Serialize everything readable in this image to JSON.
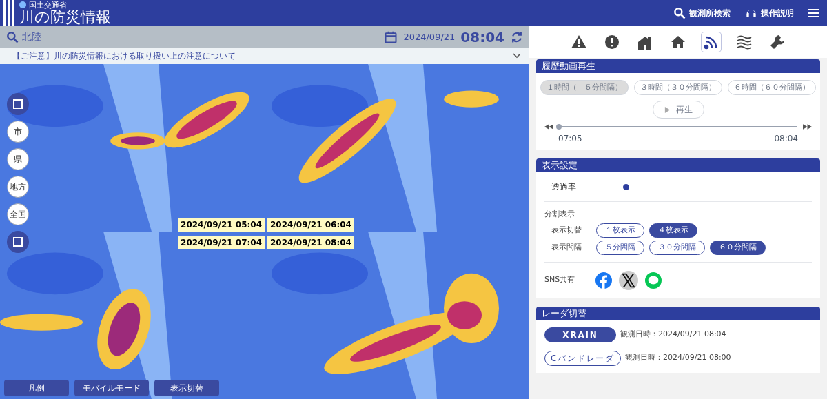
{
  "header": {
    "agency": "国土交通省",
    "title": "川の防災情報",
    "actions": [
      {
        "kind": "search",
        "label": "観測所検索"
      },
      {
        "kind": "headset",
        "label": "操作説明"
      }
    ]
  },
  "location_bar": {
    "region": "北陸",
    "date": "2024/09/21",
    "time": "08:04"
  },
  "notice": "【ご注意】川の防災情報における取り扱い上の注意について",
  "map_panels": [
    {
      "timestamp": "2024/09/21 05:04"
    },
    {
      "timestamp": "2024/09/21 06:04"
    },
    {
      "timestamp": "2024/09/21 07:04"
    },
    {
      "timestamp": "2024/09/21 08:04"
    }
  ],
  "map_controls": [
    {
      "kind": "square"
    },
    {
      "kind": "scale",
      "label": "市"
    },
    {
      "kind": "scale",
      "label": "県"
    },
    {
      "kind": "scale",
      "label": "地方"
    },
    {
      "kind": "scale",
      "label": "全国"
    },
    {
      "kind": "square"
    }
  ],
  "bottom_buttons": [
    "凡例",
    "モバイルモード",
    "表示切替"
  ],
  "nav_icons": [
    {
      "kind": "warning",
      "selected": false
    },
    {
      "kind": "alert",
      "selected": false
    },
    {
      "kind": "station",
      "selected": false
    },
    {
      "kind": "home",
      "selected": false
    },
    {
      "kind": "radar",
      "selected": true
    },
    {
      "kind": "waves",
      "selected": false
    },
    {
      "kind": "wrench",
      "selected": false
    }
  ],
  "history": {
    "title": "履歴動画再生",
    "ranges": [
      {
        "label": "１時間（　５分間隔）",
        "selected": true
      },
      {
        "label": "３時間（３０分間隔）",
        "selected": false
      },
      {
        "label": "６時間（６０分間隔）",
        "selected": false
      }
    ],
    "play": "再生",
    "level": 0,
    "start": "07:05",
    "end": "08:04"
  },
  "display": {
    "title": "表示設定",
    "opacity_label": "透過率",
    "level": 0.18,
    "split_label": "分割表示",
    "rows": [
      {
        "label": "表示切替",
        "options": [
          {
            "label": "１枚表示",
            "selected": false
          },
          {
            "label": "４枚表示",
            "selected": true
          }
        ]
      },
      {
        "label": "表示間隔",
        "options": [
          {
            "label": "５分間隔",
            "selected": false
          },
          {
            "label": "３０分間隔",
            "selected": false
          },
          {
            "label": "６０分間隔",
            "selected": true
          }
        ]
      }
    ],
    "sns_label": "SNS共有",
    "sns": [
      {
        "kind": "facebook"
      },
      {
        "kind": "x"
      },
      {
        "kind": "line"
      }
    ]
  },
  "radar": {
    "title": "レーダ切替",
    "items": [
      {
        "label": "XRAIN",
        "selected": true,
        "observed": "観測日時：2024/09/21 08:04"
      },
      {
        "label": "Cバンドレーダ",
        "selected": false,
        "observed": "観測日時：2024/09/21 08:00"
      }
    ]
  }
}
